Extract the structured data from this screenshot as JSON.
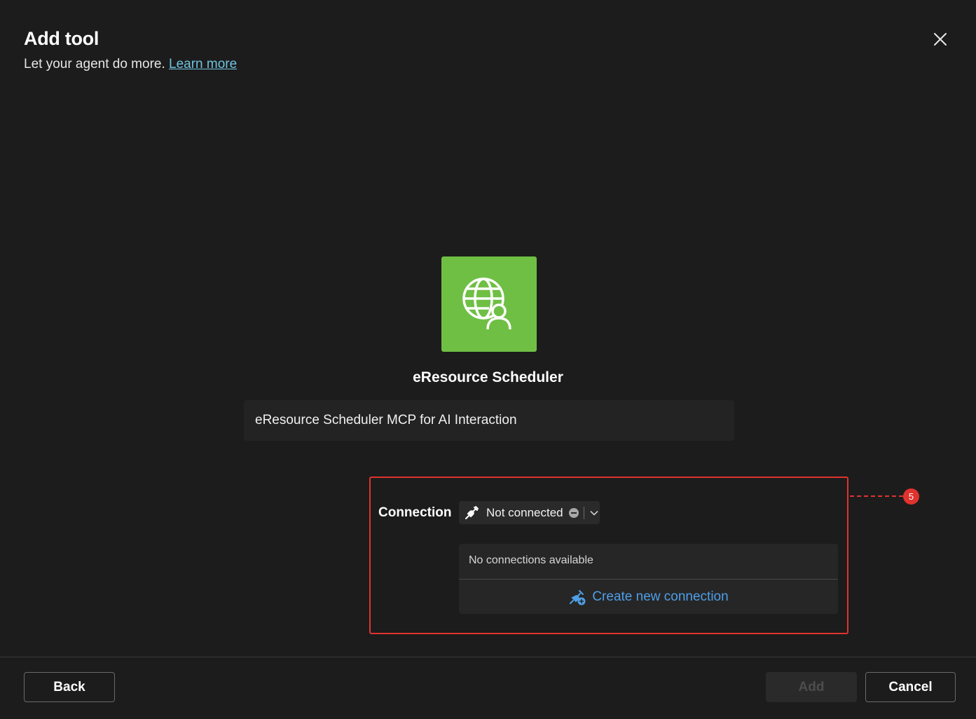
{
  "header": {
    "title": "Add tool",
    "subtitle": "Let your agent do more.",
    "learn_more": "Learn more"
  },
  "tool": {
    "name": "eResource Scheduler",
    "description": "eResource Scheduler MCP for AI Interaction",
    "icon": "globe-person-icon",
    "icon_bg": "#6fbf44"
  },
  "connection": {
    "label": "Connection",
    "selected": "Not connected",
    "empty_message": "No connections available",
    "create_label": "Create new connection"
  },
  "annotation": {
    "badge": "5",
    "color": "#e0332e"
  },
  "footer": {
    "back": "Back",
    "add": "Add",
    "cancel": "Cancel"
  },
  "colors": {
    "accent_link": "#6fc3e0",
    "accent_blue": "#4f9fe8"
  }
}
